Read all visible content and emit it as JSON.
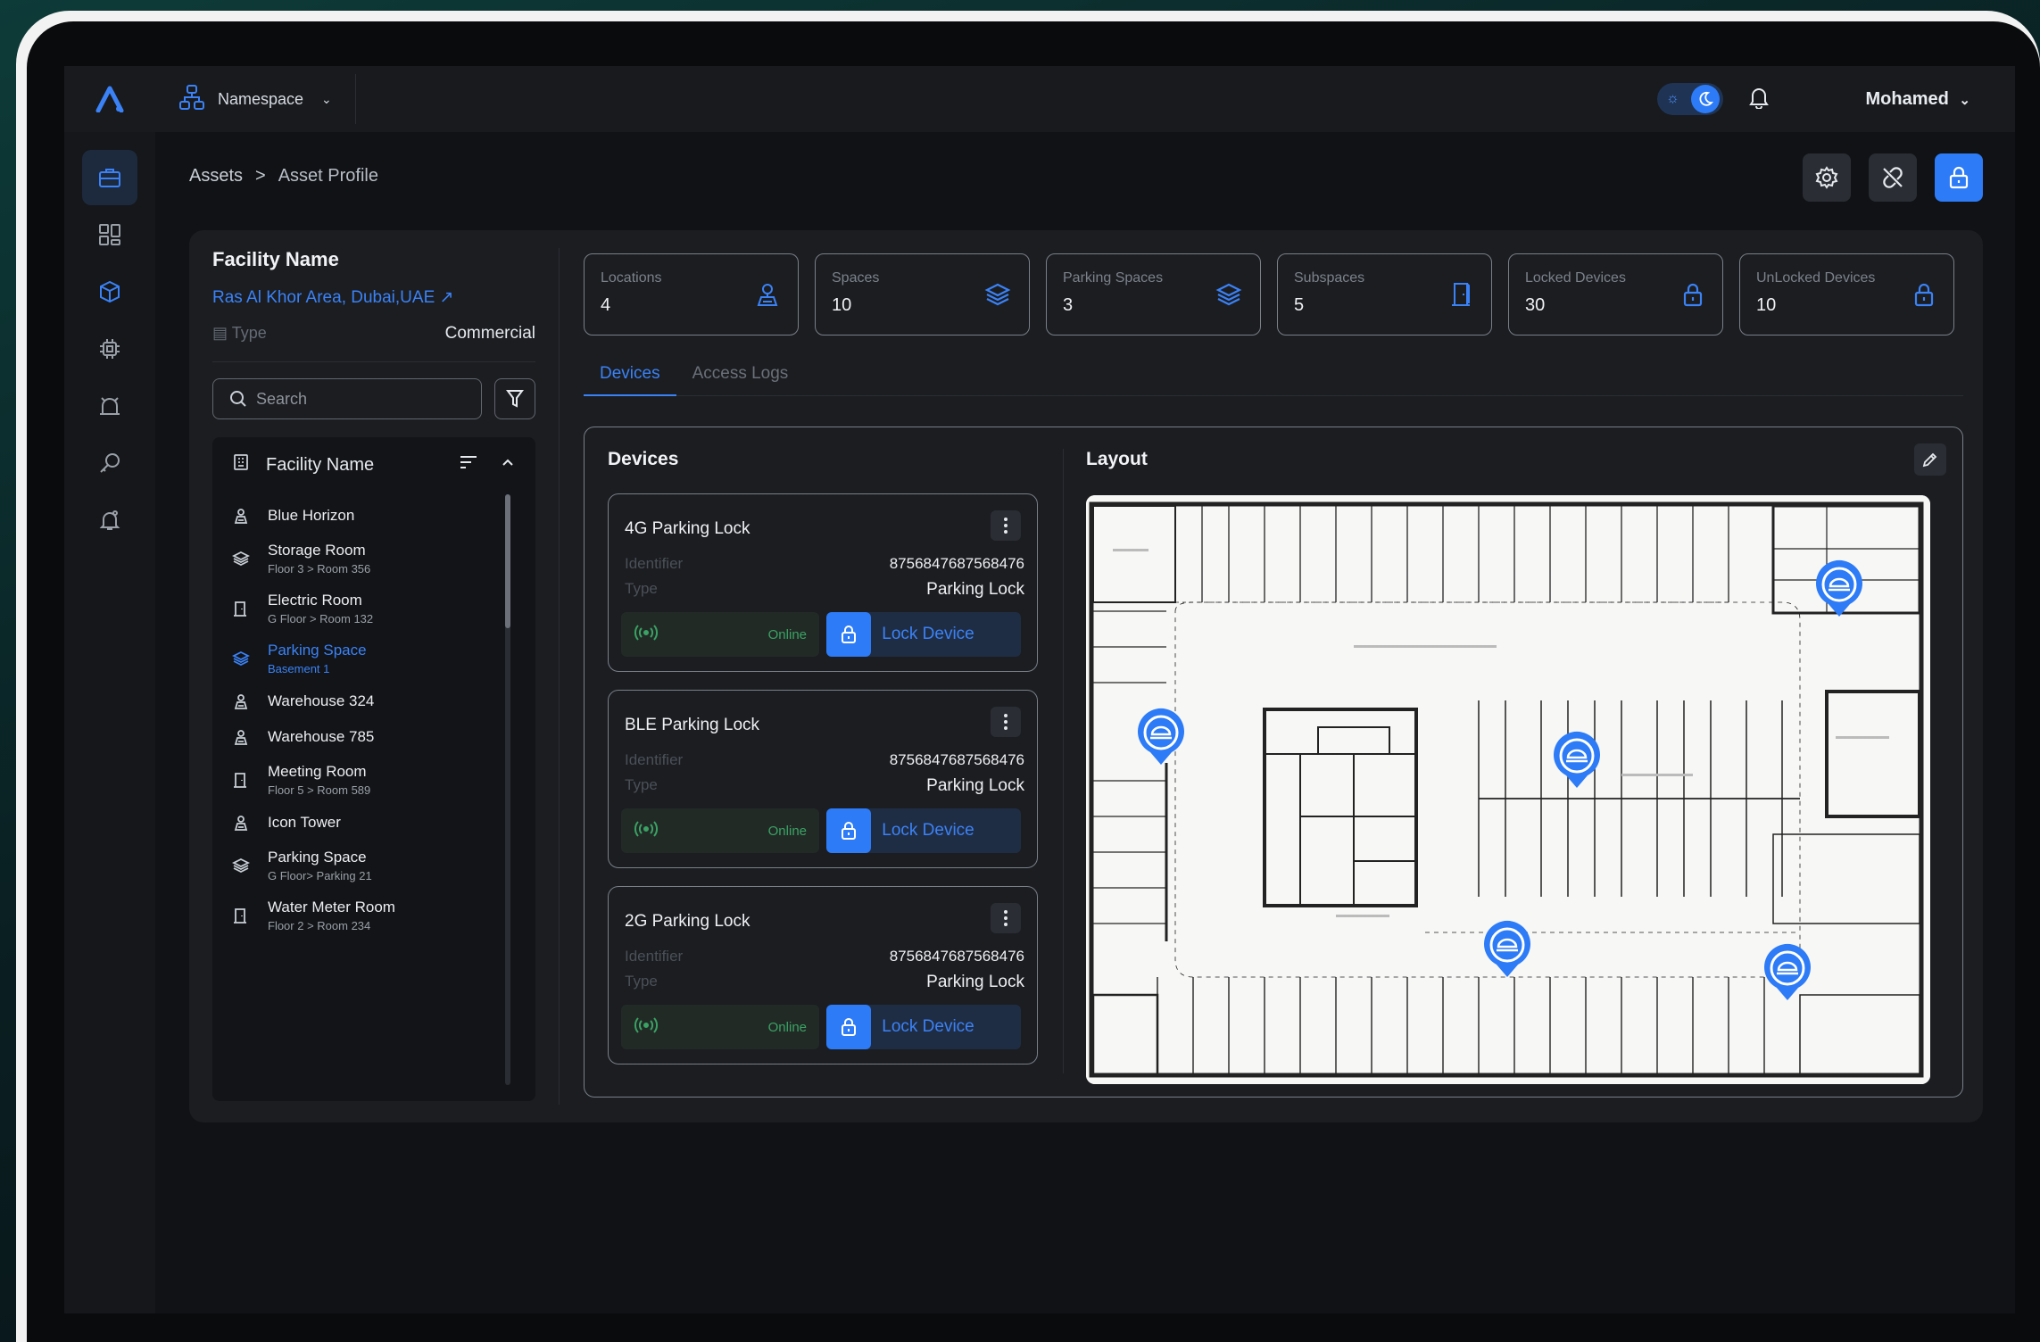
{
  "topbar": {
    "namespace_label": "Namespace",
    "user_name": "Mohamed"
  },
  "breadcrumb": {
    "root": "Assets",
    "separator": ">",
    "current": "Asset Profile"
  },
  "facility": {
    "title": "Facility Name",
    "location": "Ras Al Khor Area, Dubai,UAE ↗",
    "type_label": "Type",
    "type_value": "Commercial"
  },
  "search": {
    "placeholder": "Search"
  },
  "tree": {
    "header": "Facility Name",
    "items": [
      {
        "name": "Blue Horizon",
        "sub": "",
        "icon": "building-icon"
      },
      {
        "name": "Storage Room",
        "sub": "Floor 3 > Room 356",
        "icon": "layers-icon"
      },
      {
        "name": "Electric Room",
        "sub": "G Floor > Room 132",
        "icon": "door-icon"
      },
      {
        "name": "Parking Space",
        "sub": "Basement 1",
        "icon": "layers-icon"
      },
      {
        "name": "Warehouse 324",
        "sub": "",
        "icon": "building-icon"
      },
      {
        "name": "Warehouse 785",
        "sub": "",
        "icon": "building-icon"
      },
      {
        "name": "Meeting Room",
        "sub": "Floor 5 > Room 589",
        "icon": "door-icon"
      },
      {
        "name": "Icon Tower",
        "sub": "",
        "icon": "building-icon"
      },
      {
        "name": "Parking Space",
        "sub": "G Floor> Parking 21",
        "icon": "layers-icon"
      },
      {
        "name": "Water Meter Room",
        "sub": "Floor 2 > Room 234",
        "icon": "door-icon"
      }
    ],
    "selected_index": 3
  },
  "stats": [
    {
      "label": "Locations",
      "value": "4",
      "icon": "location-icon"
    },
    {
      "label": "Spaces",
      "value": "10",
      "icon": "layers-icon"
    },
    {
      "label": "Parking Spaces",
      "value": "3",
      "icon": "layers-icon"
    },
    {
      "label": "Subspaces",
      "value": "5",
      "icon": "door-icon"
    },
    {
      "label": "Locked Devices",
      "value": "30",
      "icon": "lock-icon"
    },
    {
      "label": "UnLocked Devices",
      "value": "10",
      "icon": "lock-icon"
    }
  ],
  "tabs": [
    {
      "label": "Devices",
      "active": true
    },
    {
      "label": "Access Logs",
      "active": false
    }
  ],
  "devices": {
    "title": "Devices",
    "items": [
      {
        "name": "4G Parking Lock",
        "identifier_label": "Identifier",
        "identifier": "8756847687568476",
        "type_label": "Type",
        "type": "Parking Lock",
        "status": "Online",
        "action": "Lock Device"
      },
      {
        "name": "BLE Parking Lock",
        "identifier_label": "Identifier",
        "identifier": "8756847687568476",
        "type_label": "Type",
        "type": "Parking Lock",
        "status": "Online",
        "action": "Lock Device"
      },
      {
        "name": "2G Parking Lock",
        "identifier_label": "Identifier",
        "identifier": "8756847687568476",
        "type_label": "Type",
        "type": "Parking Lock",
        "status": "Online",
        "action": "Lock Device"
      }
    ]
  },
  "layout": {
    "title": "Layout"
  },
  "colors": {
    "accent": "#2d7bf6",
    "online": "#3aa264",
    "panel": "#1b1d21",
    "background": "#101215"
  }
}
